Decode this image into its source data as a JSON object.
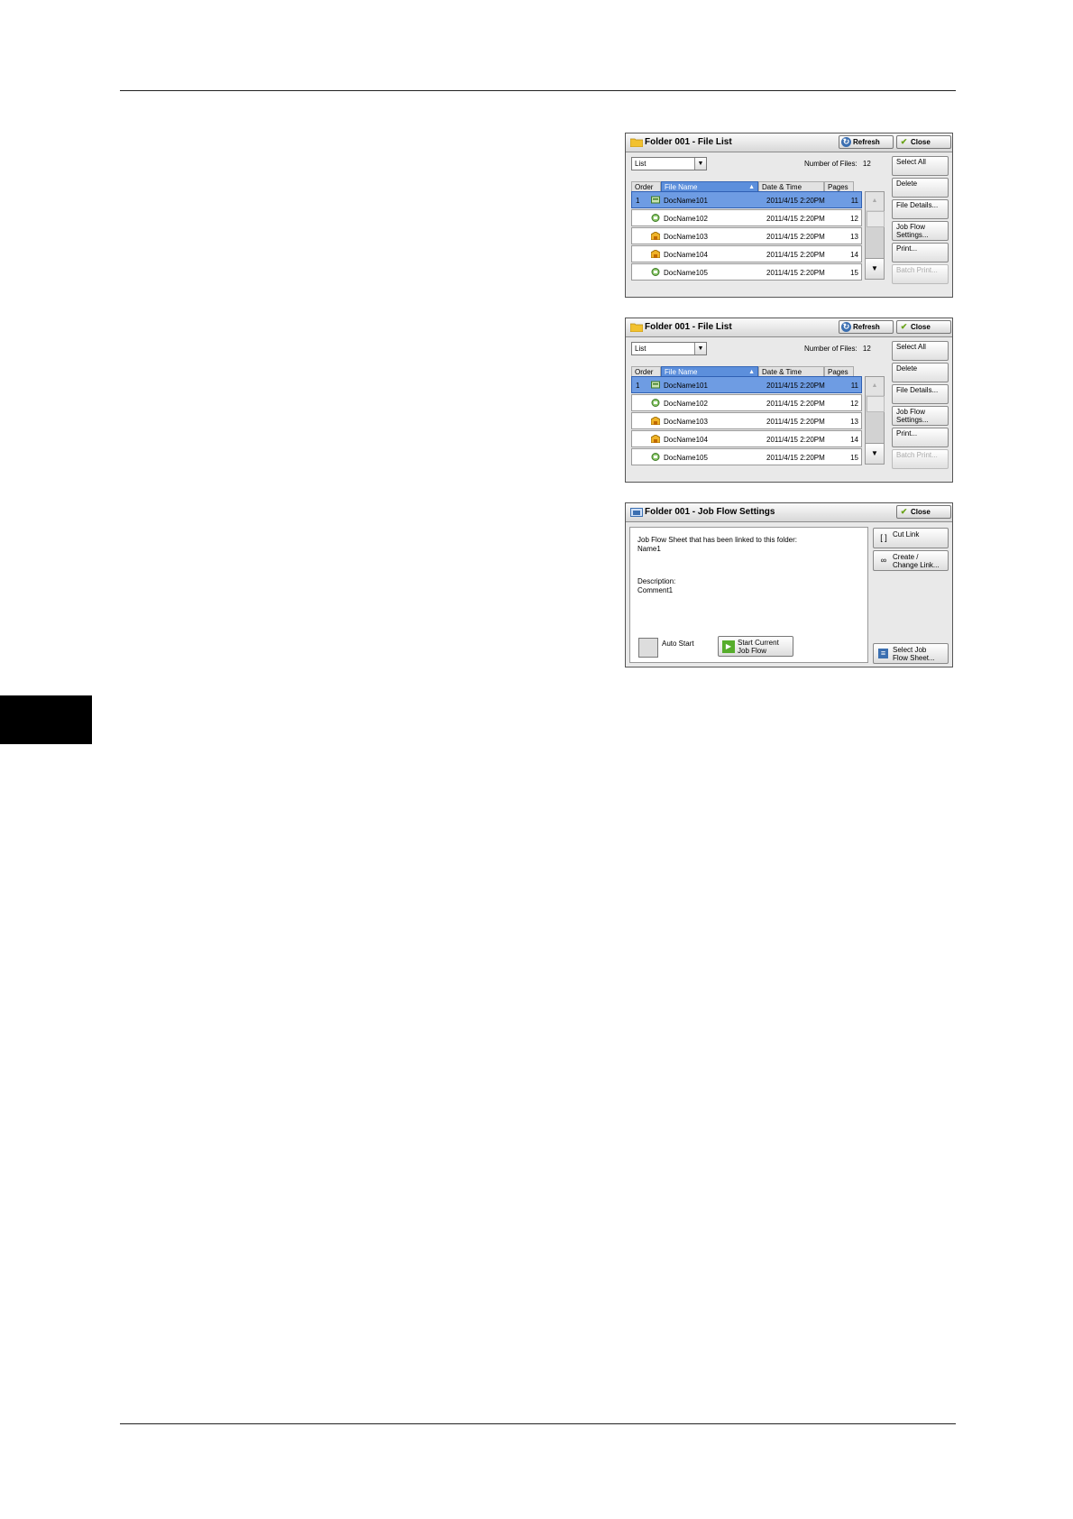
{
  "folder_panels": [
    {
      "title": "Folder 001 - File List",
      "refresh_label": "Refresh",
      "close_label": "Close",
      "view_select": "List",
      "number_of_files_label": "Number of Files:",
      "number_of_files": "12",
      "columns": [
        "Order",
        "File Name",
        "Date & Time",
        "Pages"
      ],
      "rows": [
        {
          "order": "1",
          "name": "DocName101",
          "date": "2011/4/15  2:20PM",
          "pages": "11",
          "icon": "scan-doc-icon"
        },
        {
          "order": "",
          "name": "DocName102",
          "date": "2011/4/15  2:20PM",
          "pages": "12",
          "icon": "fax-doc-icon"
        },
        {
          "order": "",
          "name": "DocName103",
          "date": "2011/4/15  2:20PM",
          "pages": "13",
          "icon": "print-doc-icon"
        },
        {
          "order": "",
          "name": "DocName104",
          "date": "2011/4/15  2:20PM",
          "pages": "14",
          "icon": "print-doc-icon"
        },
        {
          "order": "",
          "name": "DocName105",
          "date": "2011/4/15  2:20PM",
          "pages": "15",
          "icon": "fax-doc-icon"
        }
      ],
      "side_buttons": [
        "Select All",
        "Delete",
        "File Details...",
        "Job Flow Settings...",
        "Print...",
        "Batch Print..."
      ]
    },
    {
      "title": "Folder 001 - File List",
      "refresh_label": "Refresh",
      "close_label": "Close",
      "view_select": "List",
      "number_of_files_label": "Number of Files:",
      "number_of_files": "12",
      "columns": [
        "Order",
        "File Name",
        "Date & Time",
        "Pages"
      ],
      "rows": [
        {
          "order": "1",
          "name": "DocName101",
          "date": "2011/4/15  2:20PM",
          "pages": "11",
          "icon": "scan-doc-icon"
        },
        {
          "order": "",
          "name": "DocName102",
          "date": "2011/4/15  2:20PM",
          "pages": "12",
          "icon": "fax-doc-icon"
        },
        {
          "order": "",
          "name": "DocName103",
          "date": "2011/4/15  2:20PM",
          "pages": "13",
          "icon": "print-doc-icon"
        },
        {
          "order": "",
          "name": "DocName104",
          "date": "2011/4/15  2:20PM",
          "pages": "14",
          "icon": "print-doc-icon"
        },
        {
          "order": "",
          "name": "DocName105",
          "date": "2011/4/15  2:20PM",
          "pages": "15",
          "icon": "fax-doc-icon"
        }
      ],
      "side_buttons": [
        "Select All",
        "Delete",
        "File Details...",
        "Job Flow Settings...",
        "Print...",
        "Batch Print..."
      ]
    }
  ],
  "job_flow_panel": {
    "title": "Folder 001 - Job Flow Settings",
    "close_label": "Close",
    "linked_label": "Job Flow Sheet that has been linked to this folder:",
    "linked_name": "Name1",
    "description_label": "Description:",
    "description": "Comment1",
    "auto_start_label": "Auto Start",
    "start_current_label_1": "Start Current",
    "start_current_label_2": "Job Flow",
    "cut_link_label": "Cut Link",
    "create_link_label_1": "Create /",
    "create_link_label_2": "Change Link...",
    "select_sheet_label_1": "Select Job",
    "select_sheet_label_2": "Flow Sheet..."
  }
}
